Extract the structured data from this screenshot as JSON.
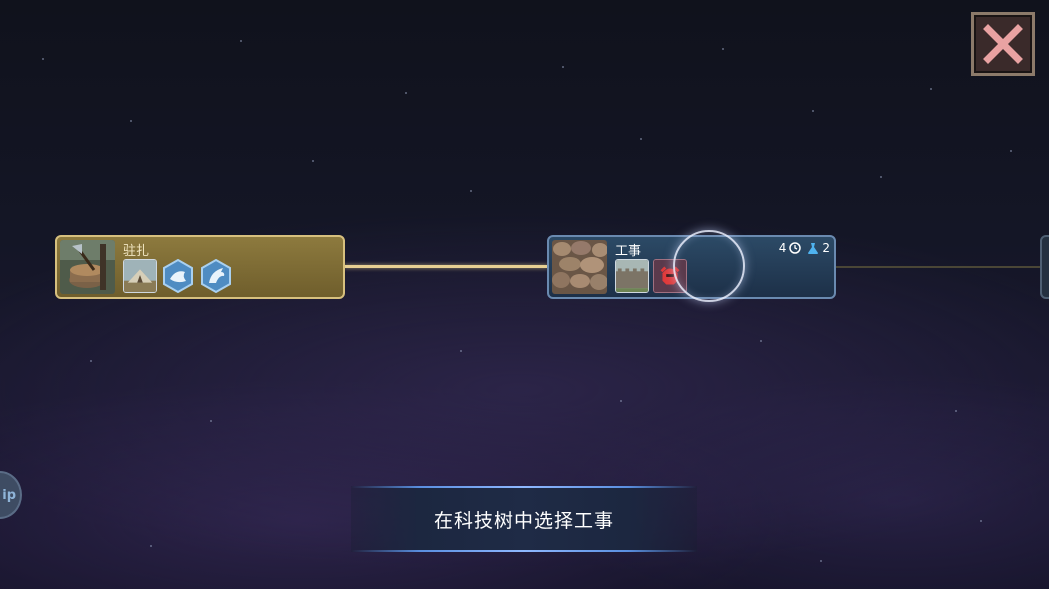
{
  "close_button": {
    "icon": "close-icon",
    "color": "#e9a2a2"
  },
  "tech_tree": {
    "nodes": [
      {
        "title": "驻扎",
        "state": "researched",
        "thumbnail": "tree-stump-axe-icon",
        "unlocks": [
          "tent-camp-icon",
          "fish-resource-icon",
          "crab-resource-icon"
        ]
      },
      {
        "title": "工事",
        "state": "selected",
        "thumbnail": "stone-wall-icon",
        "unlocks": [
          "city-walls-icon",
          "warrior-helmet-icon"
        ],
        "cost": {
          "turns": "4",
          "turns_icon": "clock-icon",
          "points": "2",
          "points_icon": "science-flask-icon"
        }
      }
    ],
    "next_node_partial": {
      "state": "locked"
    }
  },
  "side_tab": {
    "label": "ip"
  },
  "tutorial": {
    "instruction": "在科技树中选择工事"
  },
  "colors": {
    "researched_line": "#e7cf93",
    "selected_border": "#6a8ab0",
    "banner_glow": "#8fb8ff"
  }
}
